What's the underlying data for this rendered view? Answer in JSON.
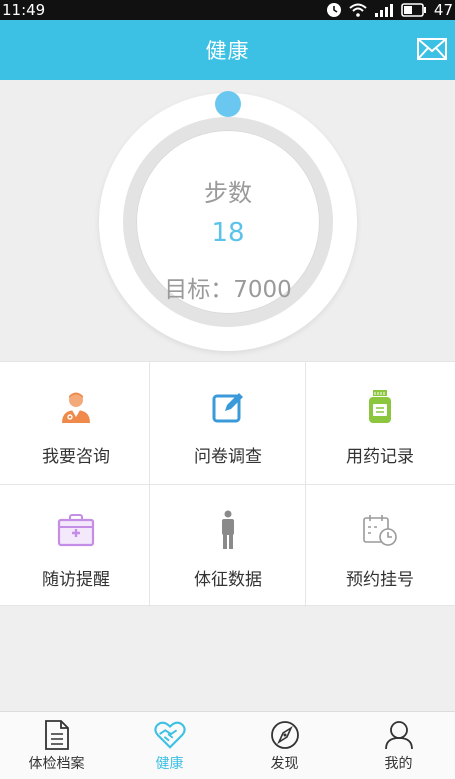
{
  "status_bar": {
    "time": "11:49",
    "battery": "47"
  },
  "header": {
    "title": "健康"
  },
  "steps": {
    "label": "步数",
    "value": "18",
    "goal": "目标：7000"
  },
  "grid": [
    {
      "label": "我要咨询",
      "icon": "doctor-icon"
    },
    {
      "label": "问卷调查",
      "icon": "edit-icon"
    },
    {
      "label": "用药记录",
      "icon": "medicine-bottle-icon"
    },
    {
      "label": "随访提醒",
      "icon": "medical-kit-icon"
    },
    {
      "label": "体征数据",
      "icon": "person-icon"
    },
    {
      "label": "预约挂号",
      "icon": "calendar-clock-icon"
    }
  ],
  "tabs": [
    {
      "label": "体检档案",
      "icon": "document-icon"
    },
    {
      "label": "健康",
      "icon": "heart-handshake-icon",
      "active": true
    },
    {
      "label": "发现",
      "icon": "compass-icon"
    },
    {
      "label": "我的",
      "icon": "user-icon"
    }
  ],
  "colors": {
    "accent": "#3cc0e4",
    "progress": "#6ac8f0"
  }
}
